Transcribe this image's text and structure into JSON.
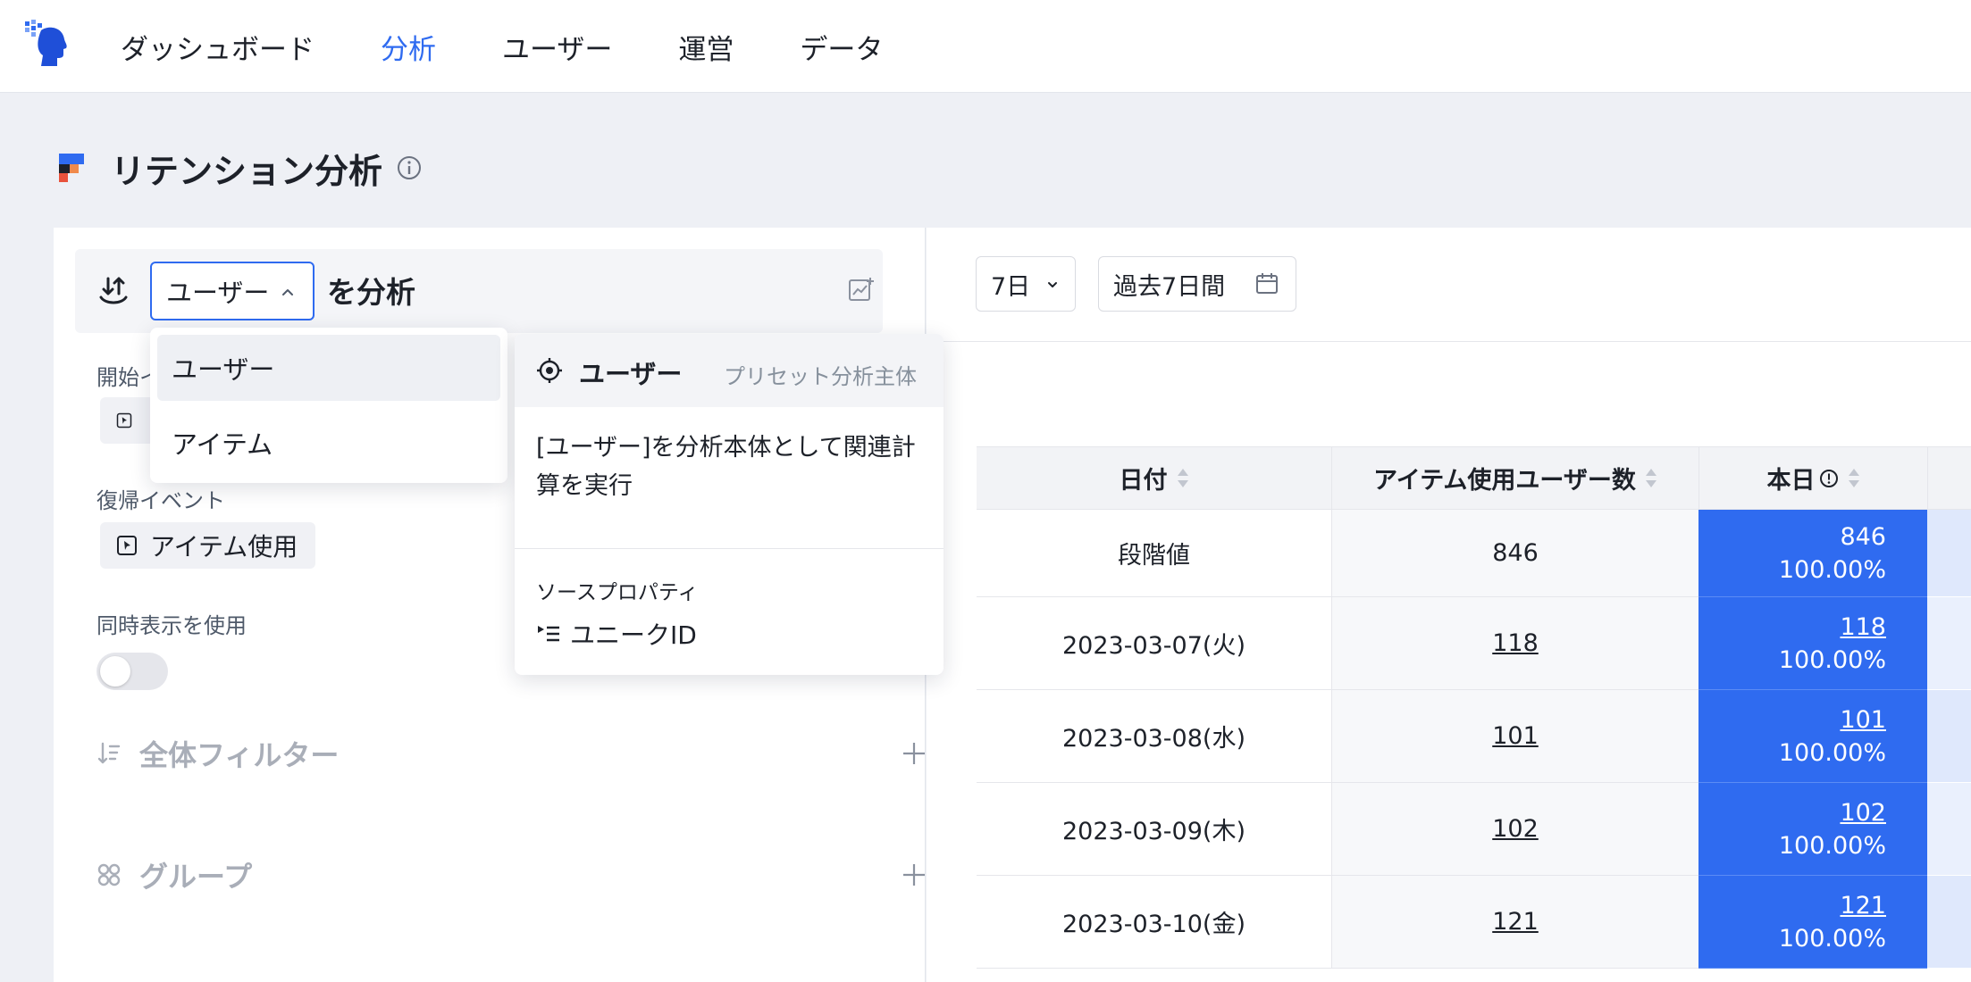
{
  "nav": {
    "items": [
      "ダッシュボード",
      "分析",
      "ユーザー",
      "運営",
      "データ"
    ],
    "active_index": 1
  },
  "page": {
    "title": "リテンション分析"
  },
  "left": {
    "subject_value": "ユーザー",
    "analyze_suffix": "を分析",
    "start_event_label": "開始イ",
    "return_event_label": "復帰イベント",
    "return_event_value": "アイテム使用",
    "simultaneous_label": "同時表示を使用",
    "simultaneous_on": false,
    "filter_label": "全体フィルター",
    "group_label": "グループ"
  },
  "dropdown": {
    "options": [
      "ユーザー",
      "アイテム"
    ],
    "selected_index": 0
  },
  "popover": {
    "title": "ユーザー",
    "preset_label": "プリセット分析主体",
    "description": "[ユーザー]を分析本体として関連計算を実行",
    "source_label": "ソースプロパティ",
    "source_value": "ユニークID"
  },
  "controls": {
    "period": "7日",
    "range": "過去7日間"
  },
  "table": {
    "headers": [
      "日付",
      "アイテム使用ユーザー数",
      "本日"
    ],
    "rows": [
      {
        "date": "段階値",
        "users": "846",
        "today_value": "846",
        "today_pct": "100.00%"
      },
      {
        "date": "2023-03-07(火)",
        "users": "118",
        "today_value": "118",
        "today_pct": "100.00%"
      },
      {
        "date": "2023-03-08(水)",
        "users": "101",
        "today_value": "101",
        "today_pct": "100.00%"
      },
      {
        "date": "2023-03-09(木)",
        "users": "102",
        "today_value": "102",
        "today_pct": "100.00%"
      },
      {
        "date": "2023-03-10(金)",
        "users": "121",
        "today_value": "121",
        "today_pct": "100.00%"
      }
    ]
  },
  "colors": {
    "accent": "#2f6bf0",
    "page_bg": "#eef0f5",
    "muted_text": "#a9aeb8"
  }
}
